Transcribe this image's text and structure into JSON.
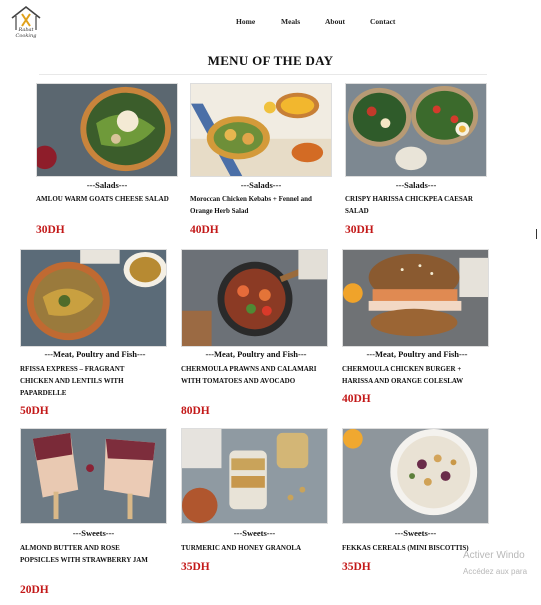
{
  "brand": {
    "logo_text": "Rabat\nCooking",
    "logo_icon": "house-utensils-icon"
  },
  "nav": [
    "Home",
    "Meals",
    "About",
    "Contact"
  ],
  "page_title": "MENU OF THE DAY",
  "colors": {
    "price": "#c31818",
    "text": "#111111"
  },
  "cards": [
    {
      "category": "---Salads---",
      "name": "AMLOU WARM GOATS CHEESE SALAD",
      "price": "30DH",
      "photo": "salad-bowl-photo"
    },
    {
      "category": "---Salads---",
      "name": "Moroccan Chicken Kebabs + Fennel and Orange Herb Salad",
      "price": "40DH",
      "photo": "chicken-kebab-photo"
    },
    {
      "category": "---Salads---",
      "name": "CRISPY HARISSA CHICKPEA CAESAR SALAD",
      "price": "30DH",
      "photo": "caesar-salad-photo"
    },
    {
      "category": "---Meat, Poultry and Fish---",
      "name": "RFISSA EXPRESS – FRAGRANT CHICKEN AND LENTILS WITH PAPARDELLE",
      "price": "50DH",
      "photo": "pasta-plate-photo"
    },
    {
      "category": "---Meat, Poultry and Fish---",
      "name": "CHERMOULA PRAWNS AND CALAMARI WITH TOMATOES AND AVOCADO",
      "price": "80DH",
      "photo": "prawns-pan-photo"
    },
    {
      "category": "---Meat, Poultry and Fish---",
      "name": "CHERMOULA CHICKEN BURGER + HARISSA AND ORANGE COLESLAW",
      "price": "40DH",
      "photo": "burger-photo"
    },
    {
      "category": "---Sweets---",
      "name": "ALMOND BUTTER AND ROSE POPSICLES WITH STRAWBERRY JAM",
      "price": "20DH",
      "photo": "popsicles-photo"
    },
    {
      "category": "---Sweets---",
      "name": "TURMERIC AND HONEY GRANOLA",
      "price": "35DH",
      "photo": "granola-jar-photo"
    },
    {
      "category": "---Sweets---",
      "name": "FEKKAS CEREALS (MINI BISCOTTIS)",
      "price": "35DH",
      "photo": "cereal-bowl-photo"
    }
  ],
  "windows_watermark": {
    "line1": "Activer Windo",
    "line2": "Accédez aux para"
  }
}
